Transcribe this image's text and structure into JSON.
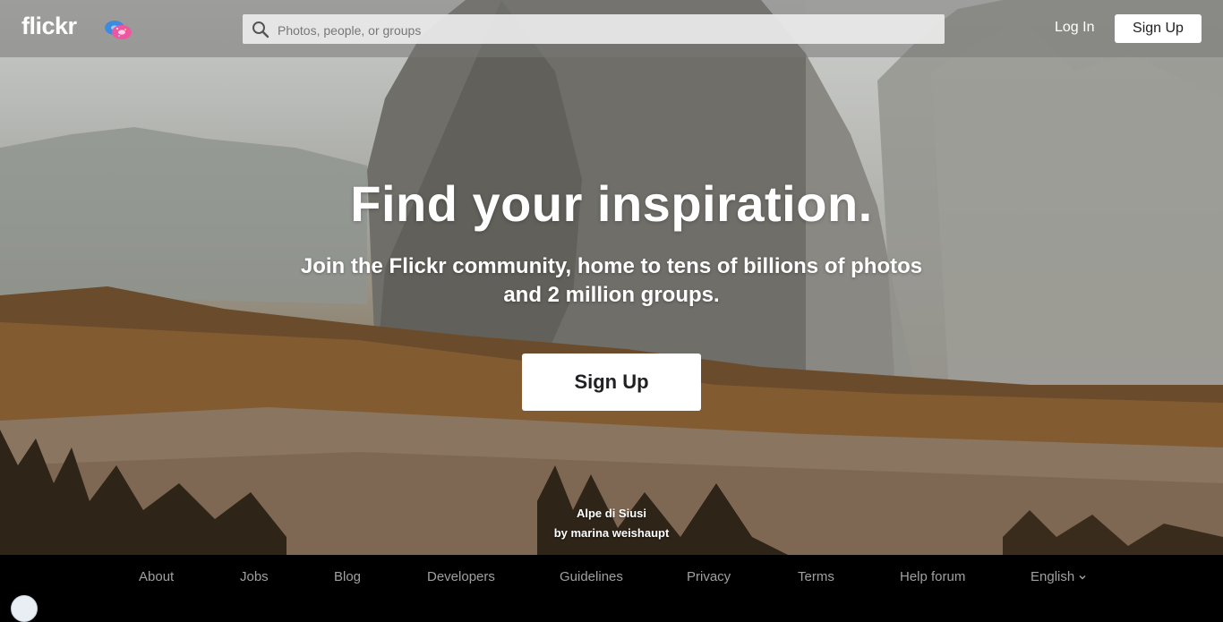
{
  "header": {
    "logo_text": "flickr",
    "search_placeholder": "Photos, people, or groups",
    "login_label": "Log In",
    "signup_label": "Sign Up"
  },
  "hero": {
    "headline": "Find your inspiration.",
    "subhead": "Join the Flickr community, home to tens of billions of photos and 2 million groups.",
    "signup_label": "Sign Up",
    "photo_title": "Alpe di Siusi",
    "photo_author": "by marina weishaupt"
  },
  "footer": {
    "links": [
      {
        "label": "About"
      },
      {
        "label": "Jobs"
      },
      {
        "label": "Blog"
      },
      {
        "label": "Developers"
      },
      {
        "label": "Guidelines"
      },
      {
        "label": "Privacy"
      },
      {
        "label": "Terms"
      },
      {
        "label": "Help forum"
      },
      {
        "label": "English"
      }
    ]
  },
  "colors": {
    "header_overlay": "#787876",
    "button_bg": "#ffffff",
    "button_text": "#212124",
    "footer_bg": "#000000",
    "footer_text": "#a0a0a0"
  }
}
